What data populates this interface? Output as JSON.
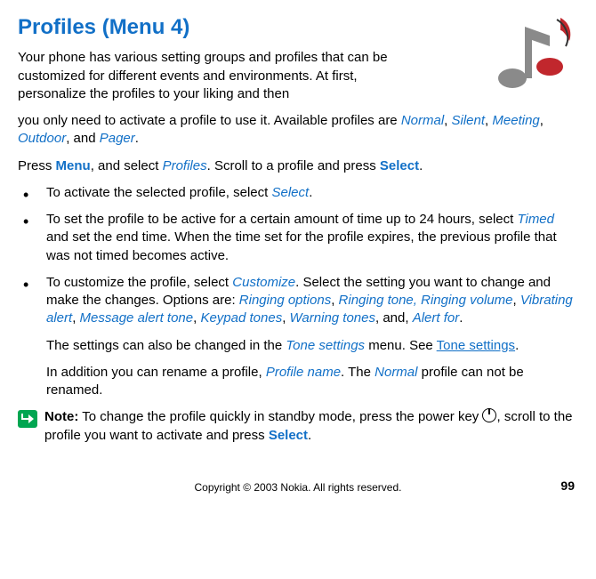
{
  "heading": "Profiles (Menu 4)",
  "intro1": "Your phone has various setting groups and profiles that can be customized for different events and environments. At first, personalize the profiles to your liking and then",
  "intro2a": "you only need to activate a profile to use it. Available profiles are ",
  "profiles": {
    "normal": "Normal",
    "silent": "Silent",
    "meeting": "Meeting",
    "outdoor": "Outdoor",
    "pager": "Pager"
  },
  "press_line": {
    "a": "Press ",
    "menu": "Menu",
    "b": ", and select ",
    "profiles": "Profiles",
    "c": ". Scroll to a profile and press ",
    "select": "Select",
    "d": "."
  },
  "bullet1": {
    "a": "To activate the selected profile, select ",
    "select": "Select",
    "b": "."
  },
  "bullet2": {
    "a": "To set the profile to be active for a certain amount of time up to 24 hours, select ",
    "timed": "Timed",
    "b": " and set the end time. When the time set for the profile expires, the previous profile that was not timed becomes active."
  },
  "bullet3": {
    "a": "To customize the profile, select ",
    "customize": "Customize",
    "b": ". Select the setting you want to change and make the changes.  Options are:  ",
    "opt1": "Ringing options",
    "c1": ", ",
    "opt2": "Ringing tone, Ringing volume",
    "c2": ", ",
    "opt3": "Vibrating alert",
    "c3": ", ",
    "opt4": "Message alert tone",
    "c4": ", ",
    "opt5": "Keypad tones",
    "c5": ", ",
    "opt6": "Warning tones",
    "c6": ", and, ",
    "opt7": "Alert for",
    "c7": "."
  },
  "after1": {
    "a": "The settings can also be changed in the ",
    "tone": "Tone settings",
    "b": " menu. See ",
    "link": "Tone settings",
    "c": "."
  },
  "after2": {
    "a": "In addition you can rename a profile, ",
    "pn": "Profile name",
    "b": ". The ",
    "normal": "Normal",
    "c": " profile can not be renamed."
  },
  "note": {
    "label": "Note:",
    "a": "  To change the profile quickly in standby mode, press the power key ",
    "b": ", scroll to the profile you want to activate and press ",
    "select": "Select",
    "c": "."
  },
  "footer": {
    "copyright": "Copyright © 2003 Nokia. All rights reserved.",
    "page": "99"
  }
}
